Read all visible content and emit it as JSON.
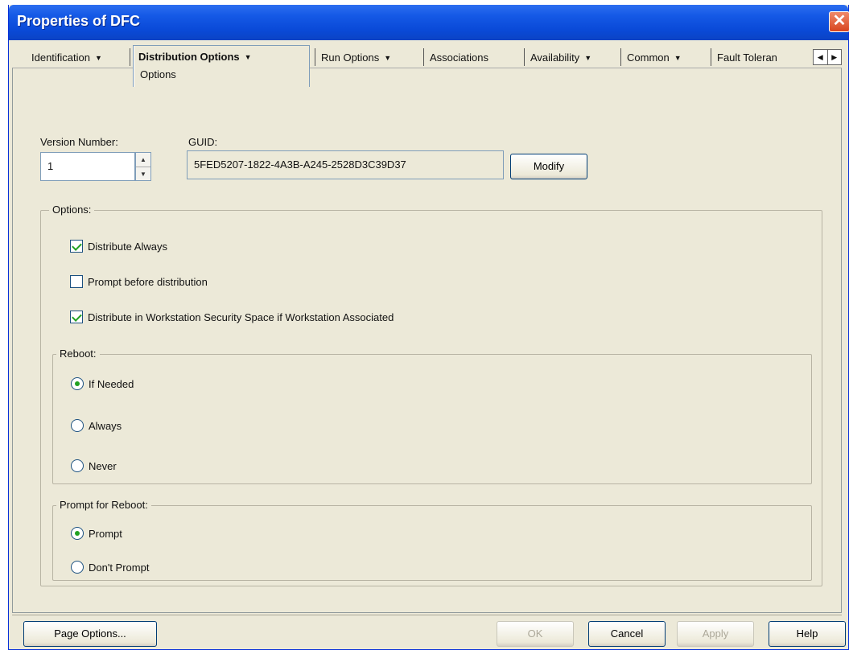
{
  "window": {
    "title": "Properties of DFC",
    "close_glyph": "✕"
  },
  "tabs": {
    "identification": {
      "label": "Identification",
      "arrow": "▼"
    },
    "distribution_options": {
      "label": "Distribution Options",
      "arrow": "▼",
      "sub_label": "Options"
    },
    "run_options": {
      "label": "Run Options",
      "arrow": "▼"
    },
    "associations": {
      "label": "Associations"
    },
    "availability": {
      "label": "Availability",
      "arrow": "▼"
    },
    "common": {
      "label": "Common",
      "arrow": "▼"
    },
    "fault_tolerance": {
      "label": "Fault Toleran"
    },
    "scroll_left": "◀",
    "scroll_right": "▶"
  },
  "version": {
    "label": "Version Number:",
    "value": "1",
    "spin_up": "▲",
    "spin_down": "▼"
  },
  "guid": {
    "label": "GUID:",
    "value": "5FED5207-1822-4A3B-A245-2528D3C39D37"
  },
  "modify_button": "Modify",
  "options": {
    "title": "Options:",
    "distribute_always": {
      "label": "Distribute Always",
      "checked": true
    },
    "prompt_before": {
      "label": "Prompt before distribution",
      "checked": false
    },
    "distribute_workstation": {
      "label": "Distribute in Workstation Security Space if Workstation Associated",
      "checked": true
    }
  },
  "reboot": {
    "title": "Reboot:",
    "if_needed": "If Needed",
    "always": "Always",
    "never": "Never",
    "selected": "If Needed"
  },
  "prompt_reboot": {
    "title": "Prompt for Reboot:",
    "prompt": "Prompt",
    "dont_prompt": "Don't Prompt",
    "selected": "Prompt"
  },
  "footer": {
    "page_options": "Page Options...",
    "ok": "OK",
    "cancel": "Cancel",
    "apply": "Apply",
    "help": "Help"
  }
}
